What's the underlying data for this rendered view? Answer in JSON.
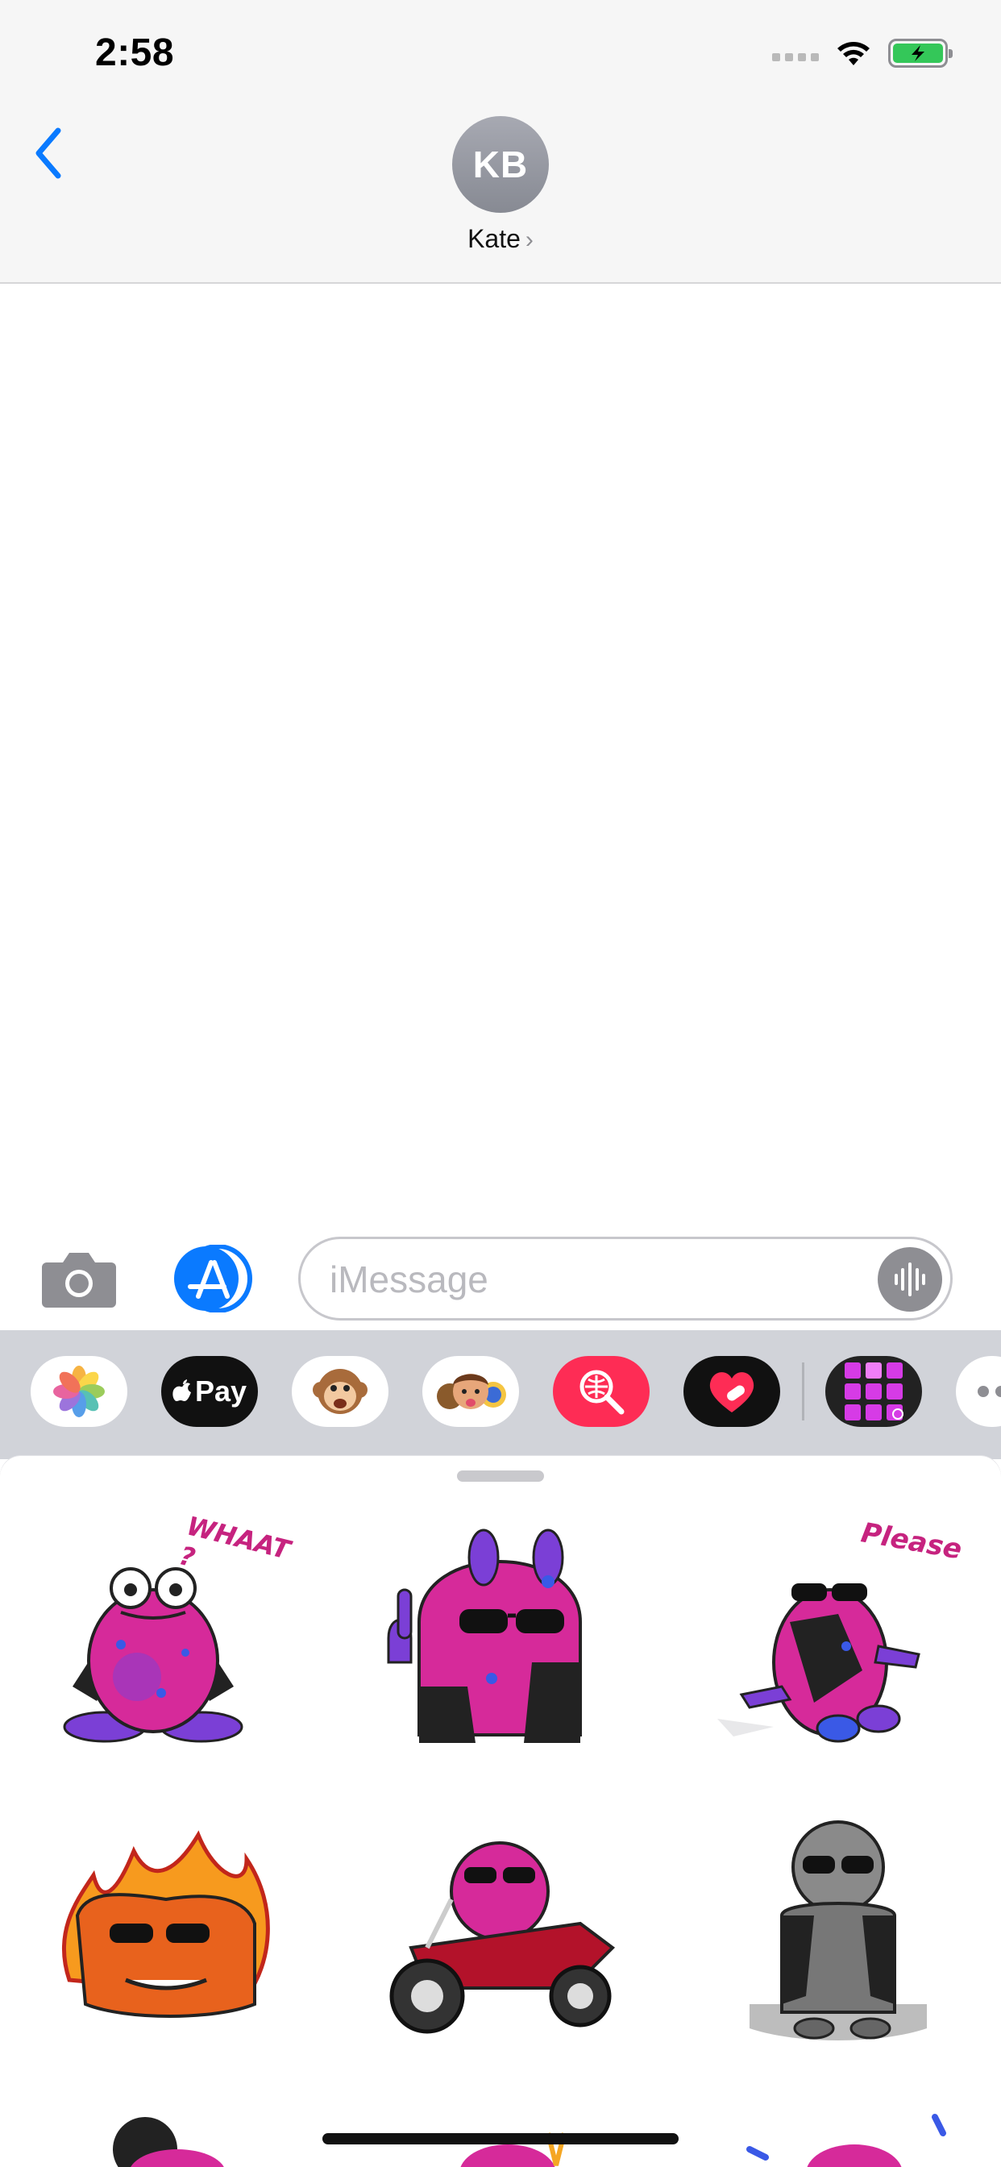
{
  "status_bar": {
    "time": "2:58"
  },
  "header": {
    "avatar_initials": "KB",
    "contact_name": "Kate",
    "chevron": "›"
  },
  "compose": {
    "placeholder": "iMessage"
  },
  "app_drawer": {
    "apps": [
      {
        "name": "photos-app-icon"
      },
      {
        "name": "apple-pay-app-icon",
        "label": "Pay"
      },
      {
        "name": "animoji-app-icon"
      },
      {
        "name": "memoji-app-icon"
      },
      {
        "name": "image-search-app-icon"
      },
      {
        "name": "digital-touch-app-icon"
      },
      {
        "name": "sticker-pack-app-icon"
      },
      {
        "name": "more-apps-icon"
      }
    ]
  },
  "stickers": {
    "items": [
      {
        "name": "sticker-frog-whaat",
        "caption": "WHAAT ?"
      },
      {
        "name": "sticker-blob-thumbs-up"
      },
      {
        "name": "sticker-frog-please",
        "caption": "Please"
      },
      {
        "name": "sticker-fire-blob"
      },
      {
        "name": "sticker-frog-motorcycle"
      },
      {
        "name": "sticker-frog-grayscale"
      }
    ]
  },
  "colors": {
    "accent_blue": "#0a7aff",
    "sticker_pink": "#d62a9a",
    "sticker_purple": "#7b3fd6",
    "battery_green": "#34c759"
  }
}
